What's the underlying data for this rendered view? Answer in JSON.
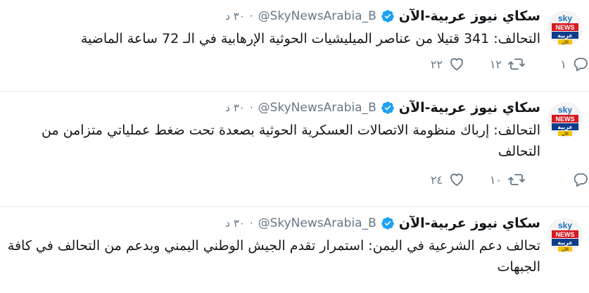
{
  "tweets": [
    {
      "name": "سكاي نيوز عربية-الآن",
      "handle": "@SkyNewsArabia_B",
      "time": "٣٠ د",
      "text": "التحالف: 341 قتيلا من عناصر الميليشيات الحوثية الإرهابية في الـ 72 ساعة الماضية",
      "replies": "١",
      "retweets": "١٢",
      "likes": "٢٢"
    },
    {
      "name": "سكاي نيوز عربية-الآن",
      "handle": "@SkyNewsArabia_B",
      "time": "٣٠ د",
      "text": "التحالف: إرباك منظومة الاتصالات العسكرية الحوثية بصعدة تحت ضغط عملياتي متزامن من التحالف",
      "replies": "",
      "retweets": "١٠",
      "likes": "٢٤"
    },
    {
      "name": "سكاي نيوز عربية-الآن",
      "handle": "@SkyNewsArabia_B",
      "time": "٣٠ د",
      "text": "تحالف دعم الشرعية في اليمن: استمرار تقدم الجيش الوطني اليمني وبدعم من التحالف في كافة الجبهات"
    }
  ],
  "avatar": {
    "logo_top": "sky",
    "logo_middle": "NEWS",
    "logo_bottom": "عربية",
    "logo_tag": "الآن"
  },
  "colors": {
    "verified": "#1da1f2",
    "muted": "#657786",
    "text": "#14171a"
  },
  "icons": {
    "reply": "reply-icon",
    "retweet": "retweet-icon",
    "like": "heart-icon",
    "verified": "verified-badge-icon"
  }
}
